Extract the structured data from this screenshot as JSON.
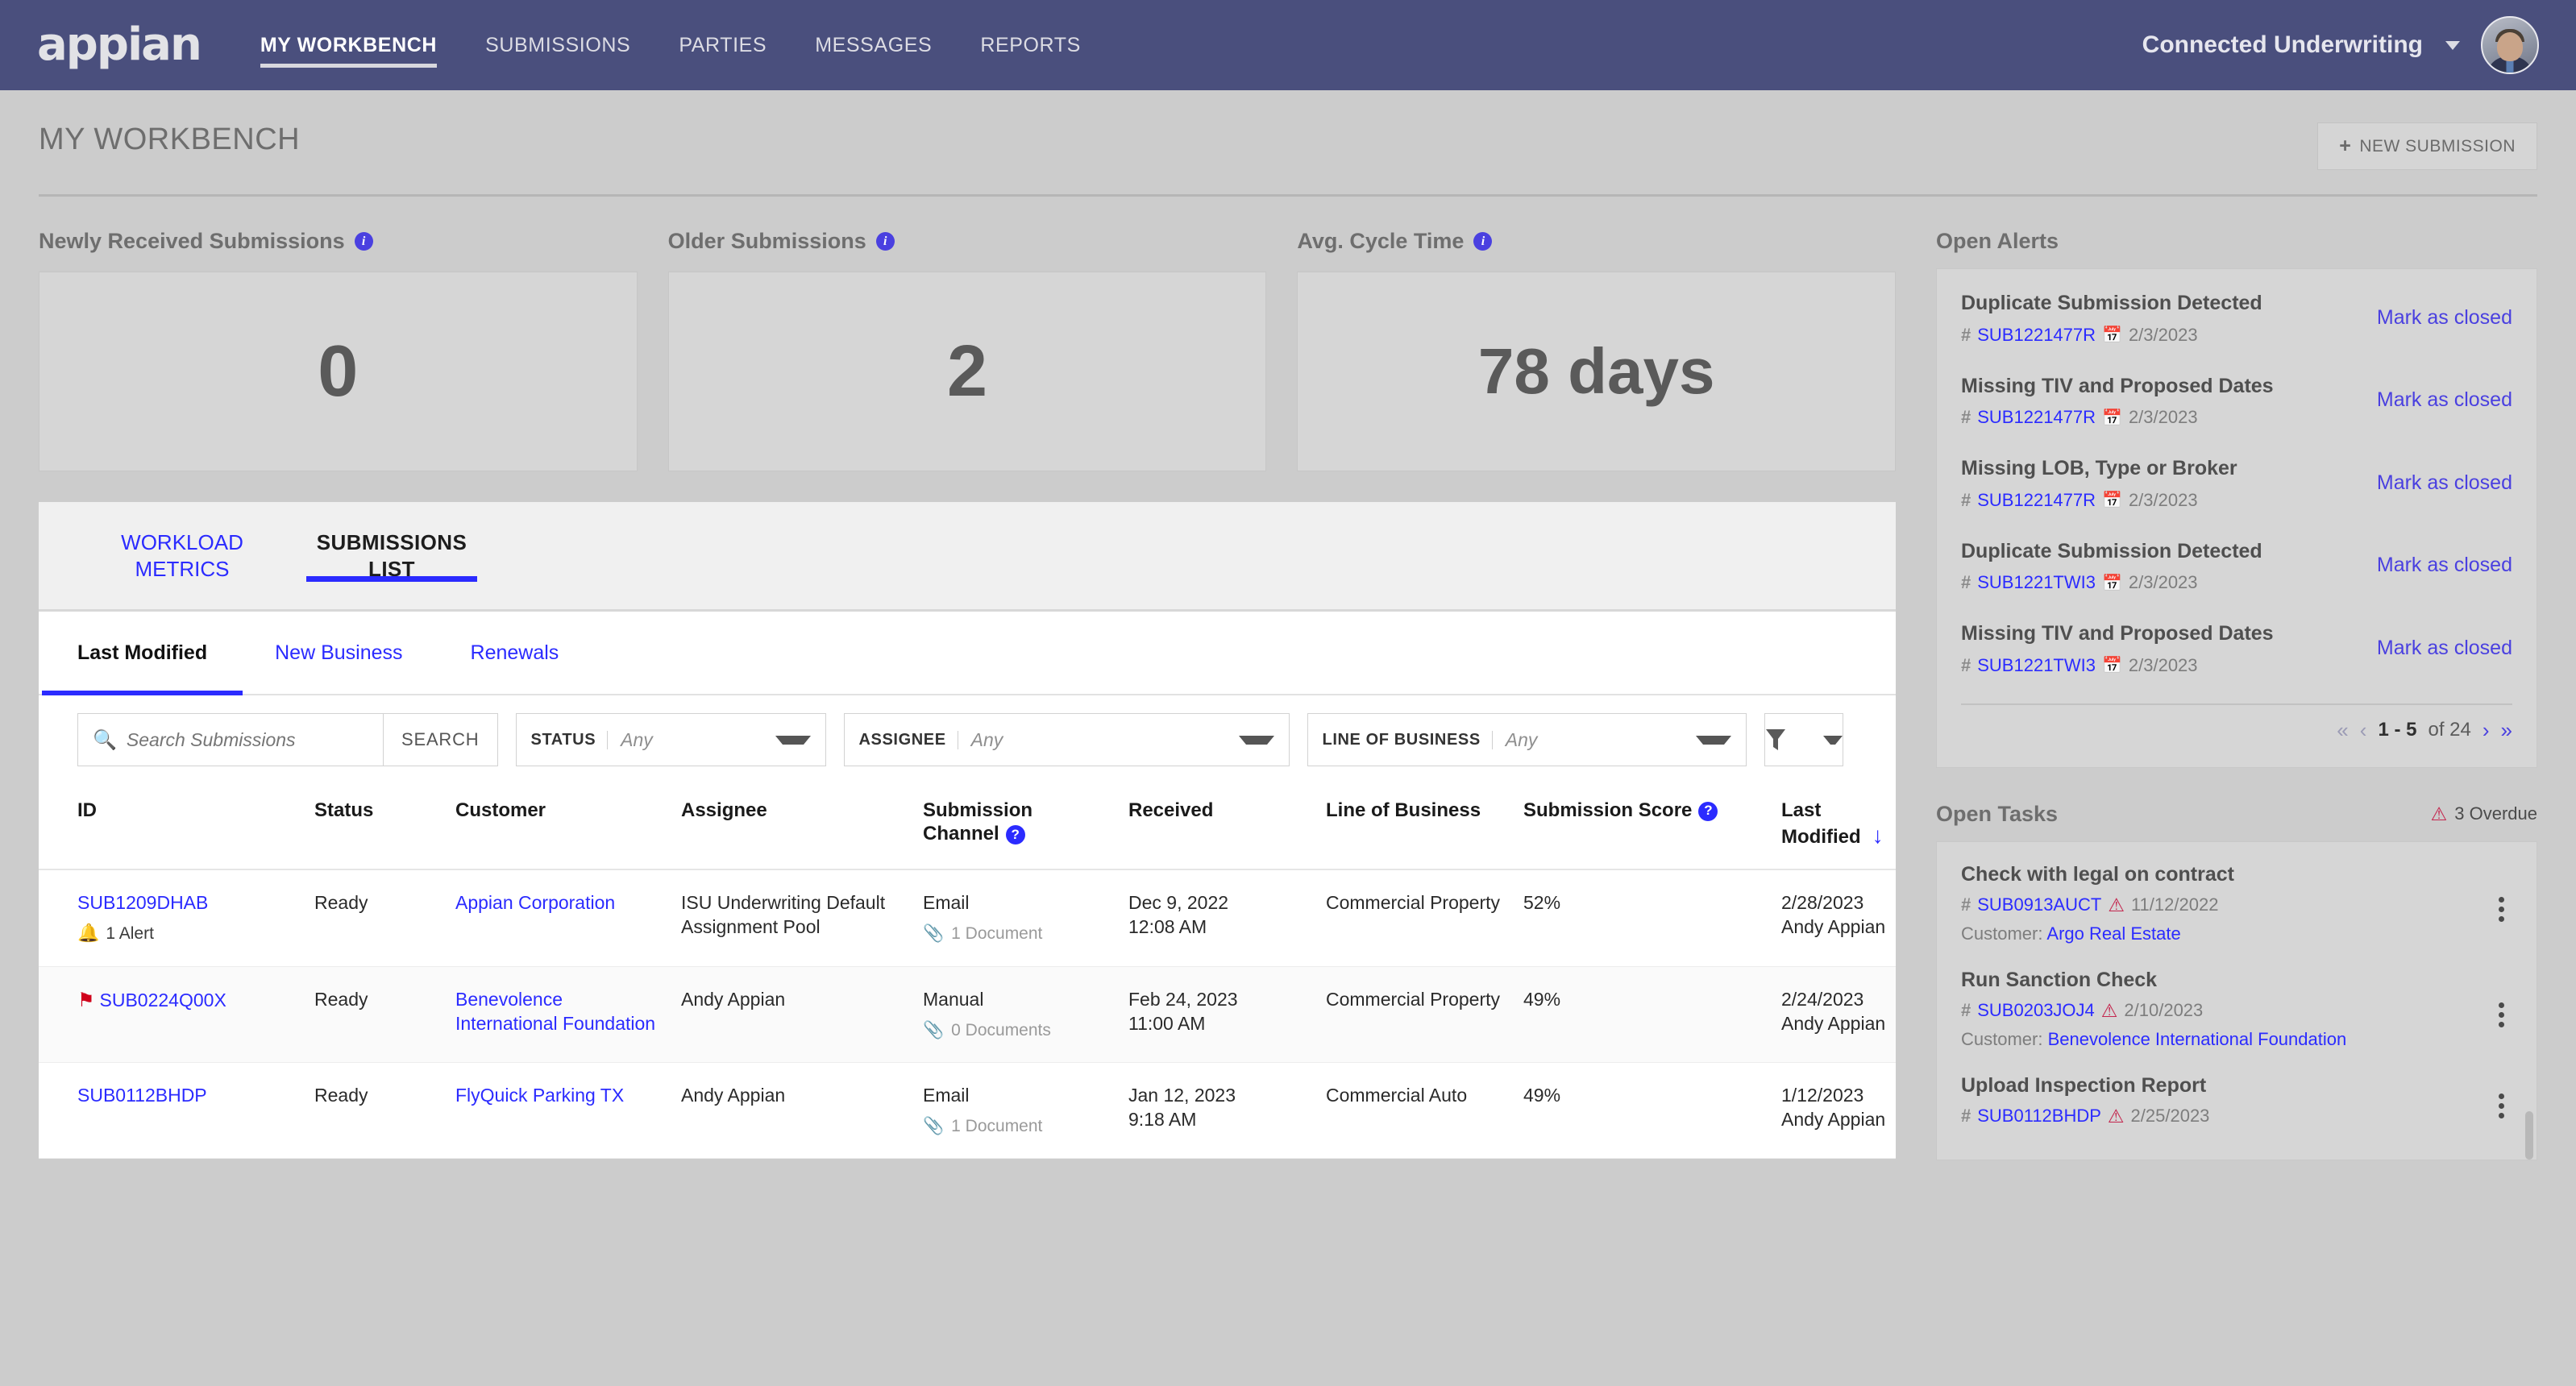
{
  "brand": {
    "logo_text": "appian",
    "accent": "#2b2bff",
    "nav_bg": "#4a4f7d"
  },
  "topnav": {
    "items": [
      {
        "label": "MY WORKBENCH",
        "active": true
      },
      {
        "label": "SUBMISSIONS",
        "active": false
      },
      {
        "label": "PARTIES",
        "active": false
      },
      {
        "label": "MESSAGES",
        "active": false
      },
      {
        "label": "REPORTS",
        "active": false
      }
    ],
    "org_name": "Connected Underwriting"
  },
  "page": {
    "title": "MY WORKBENCH",
    "new_submission_label": "NEW SUBMISSION",
    "new_submission_icon": "plus-icon"
  },
  "kpis": [
    {
      "label": "Newly Received Submissions",
      "value": "0",
      "info_icon": "info-icon"
    },
    {
      "label": "Older Submissions",
      "value": "2",
      "info_icon": "info-icon"
    },
    {
      "label": "Avg. Cycle Time",
      "value": "78 days",
      "info_icon": "info-icon"
    }
  ],
  "main_tabs": [
    {
      "label": "WORKLOAD METRICS",
      "active": false
    },
    {
      "label": "SUBMISSIONS LIST",
      "active": true
    }
  ],
  "sub_tabs": [
    {
      "label": "Last Modified",
      "active": true
    },
    {
      "label": "New Business",
      "active": false
    },
    {
      "label": "Renewals",
      "active": false
    }
  ],
  "filters": {
    "search_placeholder": "Search Submissions",
    "search_value": "",
    "search_icon": "search-icon",
    "search_button": "SEARCH",
    "status": {
      "label": "STATUS",
      "value": "Any"
    },
    "assignee": {
      "label": "ASSIGNEE",
      "value": "Any"
    },
    "line_of_business": {
      "label": "LINE OF BUSINESS",
      "value": "Any"
    },
    "funnel_icon": "funnel-icon"
  },
  "table": {
    "columns": [
      {
        "label": "ID",
        "help": false
      },
      {
        "label": "Status",
        "help": false
      },
      {
        "label": "Customer",
        "help": false
      },
      {
        "label": "Assignee",
        "help": false
      },
      {
        "label": "Submission Channel",
        "help": true
      },
      {
        "label": "Received",
        "help": false
      },
      {
        "label": "Line of Business",
        "help": false
      },
      {
        "label": "Submission Score",
        "help": true
      },
      {
        "label": "Last Modified",
        "help": false,
        "sorted": "desc"
      }
    ],
    "rows": [
      {
        "id": "SUB1209DHAB",
        "id_marker": "bell",
        "id_note": "1 Alert",
        "status": "Ready",
        "customer": "Appian Corporation",
        "assignee": "ISU Underwriting Default Assignment Pool",
        "channel": "Email",
        "channel_docs": "1 Document",
        "received_date": "Dec 9, 2022",
        "received_time": "12:08 AM",
        "line_of_business": "Commercial Property",
        "score": "52%",
        "last_modified_date": "2/28/2023",
        "last_modified_by": "Andy Appian"
      },
      {
        "id": "SUB0224Q00X",
        "id_marker": "flag",
        "id_note": "",
        "status": "Ready",
        "customer": "Benevolence International Foundation",
        "assignee": "Andy Appian",
        "channel": "Manual",
        "channel_docs": "0 Documents",
        "received_date": "Feb 24, 2023",
        "received_time": "11:00 AM",
        "line_of_business": "Commercial Property",
        "score": "49%",
        "last_modified_date": "2/24/2023",
        "last_modified_by": "Andy Appian"
      },
      {
        "id": "SUB0112BHDP",
        "id_marker": "none",
        "id_note": "",
        "status": "Ready",
        "customer": "FlyQuick Parking TX",
        "assignee": "Andy Appian",
        "channel": "Email",
        "channel_docs": "1 Document",
        "received_date": "Jan 12, 2023",
        "received_time": "9:18 AM",
        "line_of_business": "Commercial Auto",
        "score": "49%",
        "last_modified_date": "1/12/2023",
        "last_modified_by": "Andy Appian"
      }
    ]
  },
  "open_alerts": {
    "title": "Open Alerts",
    "items": [
      {
        "title": "Duplicate Submission Detected",
        "submission_id": "SUB1221477R",
        "date": "2/3/2023",
        "action": "Mark as closed"
      },
      {
        "title": "Missing TIV and Proposed Dates",
        "submission_id": "SUB1221477R",
        "date": "2/3/2023",
        "action": "Mark as closed"
      },
      {
        "title": "Missing LOB, Type or Broker",
        "submission_id": "SUB1221477R",
        "date": "2/3/2023",
        "action": "Mark as closed"
      },
      {
        "title": "Duplicate Submission Detected",
        "submission_id": "SUB1221TWI3",
        "date": "2/3/2023",
        "action": "Mark as closed"
      },
      {
        "title": "Missing TIV and Proposed Dates",
        "submission_id": "SUB1221TWI3",
        "date": "2/3/2023",
        "action": "Mark as closed"
      }
    ],
    "pager": {
      "range": "1 - 5",
      "of": "of 24",
      "first": "«",
      "prev": "‹",
      "next": "›",
      "last": "»"
    }
  },
  "open_tasks": {
    "title": "Open Tasks",
    "overdue_text": "3 Overdue",
    "overdue_icon": "warning-triangle-icon",
    "items": [
      {
        "title": "Check with legal on contract",
        "submission_id": "SUB0913AUCT",
        "due": "11/12/2022",
        "customer_label": "Customer:",
        "customer": "Argo Real Estate"
      },
      {
        "title": "Run Sanction Check",
        "submission_id": "SUB0203JOJ4",
        "due": "2/10/2023",
        "customer_label": "Customer:",
        "customer": "Benevolence International Foundation"
      },
      {
        "title": "Upload Inspection Report",
        "submission_id": "SUB0112BHDP",
        "due": "2/25/2023",
        "customer_label": "Customer:",
        "customer": ""
      }
    ]
  }
}
